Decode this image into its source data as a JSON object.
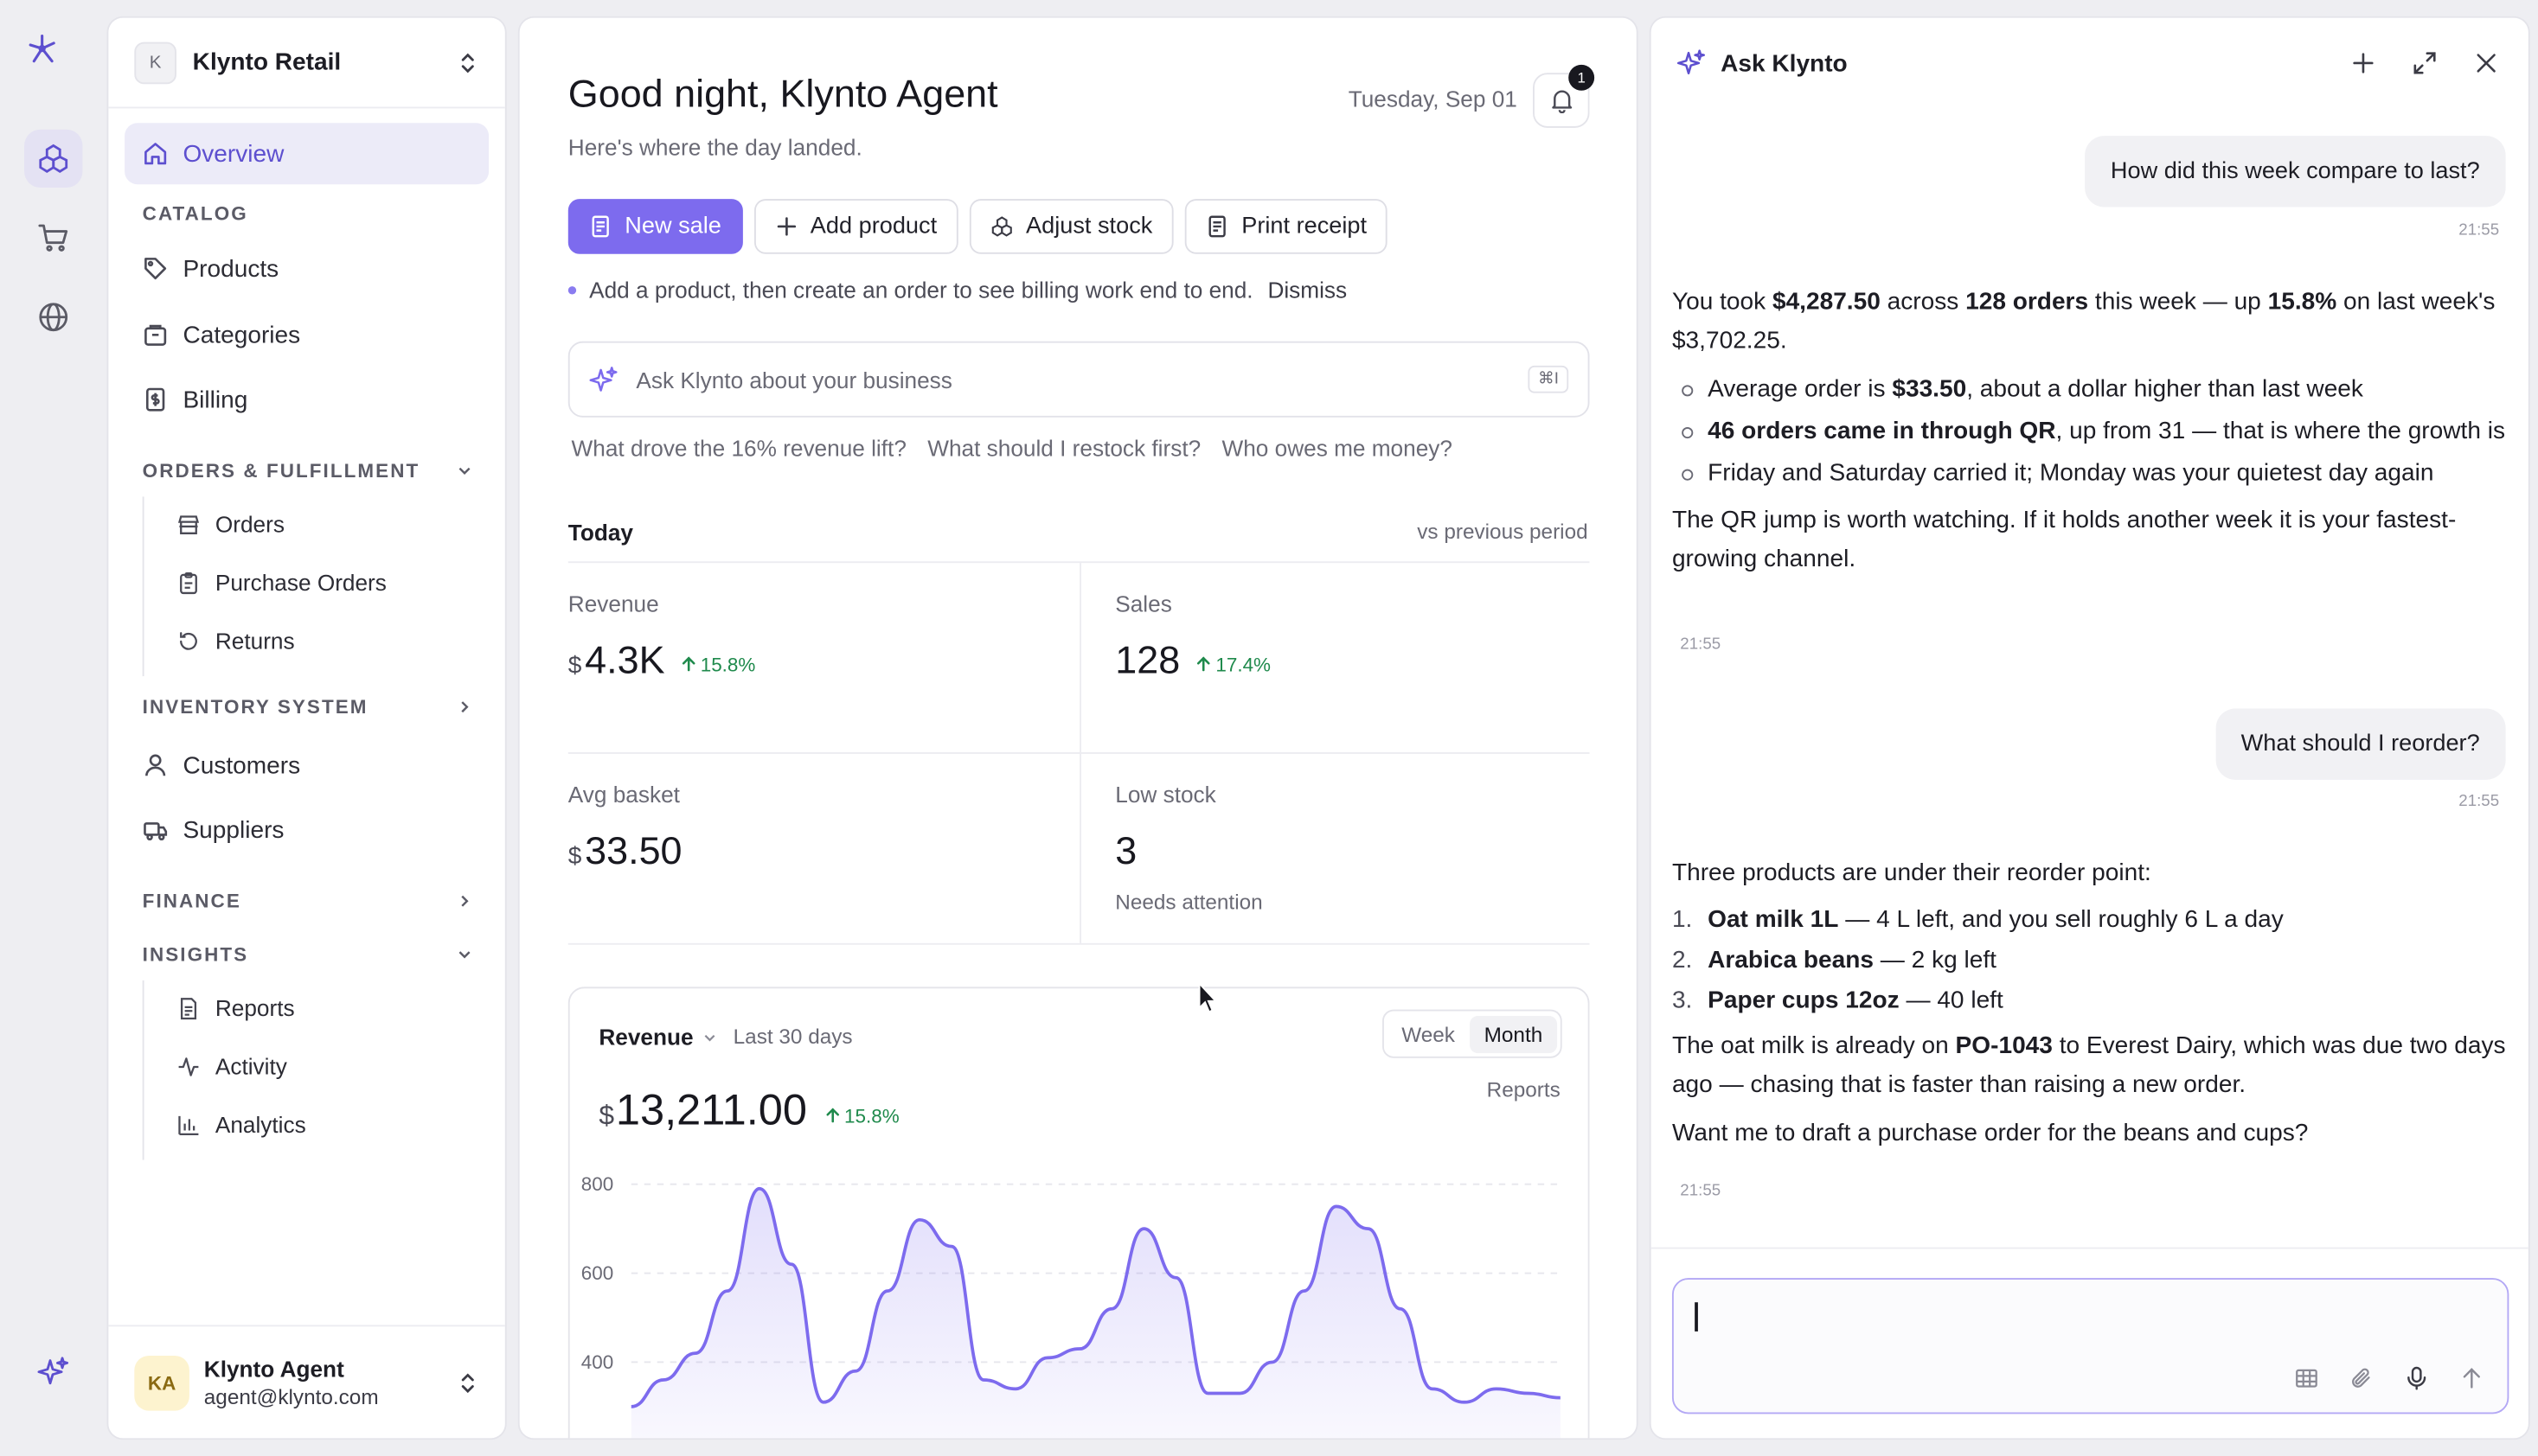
{
  "org": {
    "initial": "K",
    "name": "Klynto Retail"
  },
  "nav": {
    "overview": "Overview",
    "catalog_header": "CATALOG",
    "products": "Products",
    "categories": "Categories",
    "billing": "Billing",
    "orders_header": "ORDERS & FULFILLMENT",
    "orders": "Orders",
    "purchase_orders": "Purchase Orders",
    "returns": "Returns",
    "inventory_header": "INVENTORY SYSTEM",
    "customers": "Customers",
    "suppliers": "Suppliers",
    "finance_header": "FINANCE",
    "insights_header": "INSIGHTS",
    "reports": "Reports",
    "activity": "Activity",
    "analytics": "Analytics"
  },
  "user": {
    "initials": "KA",
    "name": "Klynto Agent",
    "email": "agent@klynto.com"
  },
  "header": {
    "greeting": "Good night, Klynto Agent",
    "subtitle": "Here's where the day landed.",
    "date": "Tuesday, Sep 01",
    "notification_count": "1"
  },
  "actions": {
    "new_sale": "New sale",
    "add_product": "Add product",
    "adjust_stock": "Adjust stock",
    "print_receipt": "Print receipt"
  },
  "hint": {
    "text": "Add a product, then create an order to see billing work end to end.",
    "dismiss": "Dismiss"
  },
  "ask": {
    "placeholder": "Ask Klynto about your business",
    "shortcut": "⌘I",
    "suggestions": [
      "What drove the 16% revenue lift?",
      "What should I restock first?",
      "Who owes me money?"
    ]
  },
  "today": {
    "title": "Today",
    "compare": "vs previous period",
    "revenue": {
      "label": "Revenue",
      "currency": "$",
      "value": "4.3K",
      "change": "15.8%"
    },
    "sales": {
      "label": "Sales",
      "value": "128",
      "change": "17.4%"
    },
    "avg_basket": {
      "label": "Avg basket",
      "currency": "$",
      "value": "33.50"
    },
    "low_stock": {
      "label": "Low stock",
      "value": "3",
      "note": "Needs attention"
    }
  },
  "revenue_card": {
    "title": "Revenue",
    "period": "Last 30 days",
    "toggle_week": "Week",
    "toggle_month": "Month",
    "reports_link": "Reports",
    "currency": "$",
    "total": "13,211.00",
    "change": "15.8%"
  },
  "chart_data": {
    "type": "area",
    "title": "Revenue",
    "xlabel": "",
    "ylabel": "",
    "ylim": [
      300,
      850
    ],
    "yticks": [
      800,
      600,
      400
    ],
    "grid": true,
    "x": [
      1,
      2,
      3,
      4,
      5,
      6,
      7,
      8,
      9,
      10,
      11,
      12,
      13,
      14,
      15,
      16,
      17,
      18,
      19,
      20,
      21,
      22,
      23,
      24,
      25,
      26,
      27,
      28,
      29,
      30
    ],
    "values": [
      300,
      360,
      420,
      560,
      790,
      620,
      310,
      380,
      560,
      720,
      660,
      360,
      340,
      410,
      430,
      520,
      700,
      590,
      330,
      330,
      400,
      560,
      750,
      700,
      520,
      340,
      310,
      340,
      330,
      320
    ],
    "color": "#7d6bee"
  },
  "chat": {
    "title": "Ask Klynto",
    "q1": "How did this week compare to last?",
    "q1_time": "21:55",
    "a1": {
      "p1_a": "You took ",
      "p1_b": "$4,287.50",
      "p1_c": " across ",
      "p1_d": "128 orders",
      "p1_e": " this week — up ",
      "p1_f": "15.8%",
      "p1_g": " on last week's $3,702.25.",
      "b1_a": "Average order is ",
      "b1_b": "$33.50",
      "b1_c": ", about a dollar higher than last week",
      "b2_a": "46 orders came in through QR",
      "b2_b": ", up from 31 — that is where the growth is",
      "b3": "Friday and Saturday carried it; Monday was your quietest day again",
      "p2": "The QR jump is worth watching. If it holds another week it is your fastest-growing channel.",
      "time": "21:55"
    },
    "q2": "What should I reorder?",
    "q2_time": "21:55",
    "a2": {
      "intro": "Three products are under their reorder point:",
      "i1_n": "1.",
      "i1_a": "Oat milk 1L",
      "i1_b": " — 4 L left, and you sell roughly 6 L a day",
      "i2_n": "2.",
      "i2_a": "Arabica beans",
      "i2_b": " — 2 kg left",
      "i3_n": "3.",
      "i3_a": "Paper cups 12oz",
      "i3_b": " — 40 left",
      "p2_a": "The oat milk is already on ",
      "p2_b": "PO-1043",
      "p2_c": " to Everest Dairy, which was due two days ago — chasing that is faster than raising a new order.",
      "p3": "Want me to draft a purchase order for the beans and cups?",
      "time": "21:55"
    }
  }
}
